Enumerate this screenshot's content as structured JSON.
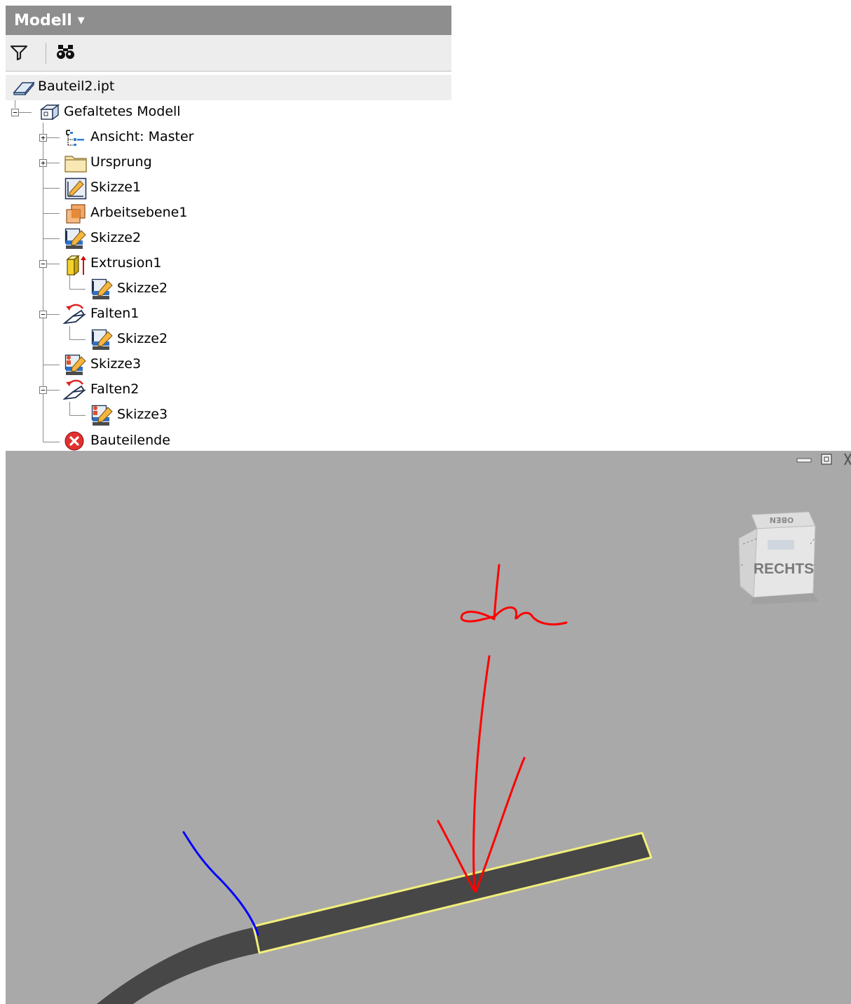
{
  "browser": {
    "header_title": "Modell",
    "root_file": "Bauteil2.ipt",
    "tree": [
      {
        "label": "Gefaltetes Modell",
        "icon": "folded-model-icon"
      },
      {
        "label": "Ansicht: Master",
        "icon": "view-rep-icon"
      },
      {
        "label": "Ursprung",
        "icon": "folder-icon"
      },
      {
        "label": "Skizze1",
        "icon": "sketch-2d-icon"
      },
      {
        "label": "Arbeitsebene1",
        "icon": "work-plane-icon"
      },
      {
        "label": "Skizze2",
        "icon": "sketch-shared-icon"
      },
      {
        "label": "Extrusion1",
        "icon": "extrusion-icon"
      },
      {
        "label": "Skizze2",
        "icon": "sketch-shared-icon"
      },
      {
        "label": "Falten1",
        "icon": "fold-icon"
      },
      {
        "label": "Skizze2",
        "icon": "sketch-shared-icon"
      },
      {
        "label": "Skizze3",
        "icon": "sketch-multi-icon"
      },
      {
        "label": "Falten2",
        "icon": "fold-icon"
      },
      {
        "label": "Skizze3",
        "icon": "sketch-multi-icon"
      },
      {
        "label": "Bauteilende",
        "icon": "end-of-part-icon"
      }
    ]
  },
  "viewport": {
    "viewcube_front": "RECHTS",
    "viewcube_top": "OBEN",
    "annotation_text": "da",
    "colors": {
      "background": "#a9a9a9",
      "part": "#474747",
      "highlight": "#f2ef7a",
      "annotation_red": "#ff0000",
      "annotation_blue": "#0000ff"
    }
  }
}
